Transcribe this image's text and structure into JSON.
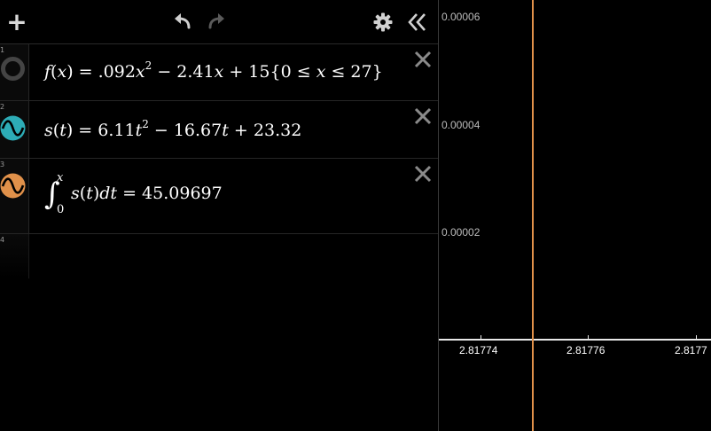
{
  "toolbar": {
    "add_label": "+"
  },
  "expressions": [
    {
      "index": "1",
      "color": "#444444",
      "icon": "hidden-circle-icon",
      "latex": "f(x) = .092x^2 - 2.41x + 15{0 ≤ x ≤ 27}",
      "parts": {
        "name": "f",
        "open": "(",
        "var": "x",
        "close": ")",
        "eq": " = .092",
        "x1": "x",
        "exp": "2",
        "mid": " − 2.41",
        "x2": "x",
        "tail": " + 15",
        "lbrace": "{",
        "c0": "0 ≤ ",
        "cx": "x",
        "c1": " ≤ 27",
        "rbrace": "}"
      }
    },
    {
      "index": "2",
      "color": "#2dacb6",
      "icon": "wave-icon",
      "parts": {
        "name": "s",
        "open": "(",
        "var": "t",
        "close": ")",
        "eq": " = 6.11",
        "t1": "t",
        "exp": "2",
        "mid": " − 16.67",
        "t2": "t",
        "tail": " + 23.32"
      }
    },
    {
      "index": "3",
      "color": "#e1914a",
      "icon": "wave-icon",
      "parts": {
        "integral": "∫",
        "upper": "x",
        "lower": "0",
        "name": "s",
        "open": "(",
        "var": "t",
        "close": ")",
        "d": "dt",
        "eq": " = 45.09697"
      }
    },
    {
      "index": "4"
    }
  ],
  "graph": {
    "y_ticks": [
      "0.00006",
      "0.00004",
      "0.00002"
    ],
    "x_ticks": [
      "2.81774",
      "2.81776",
      "2.8177"
    ],
    "vertical_line_color": "#e1914a",
    "axis_color": "#e8e8e8"
  }
}
